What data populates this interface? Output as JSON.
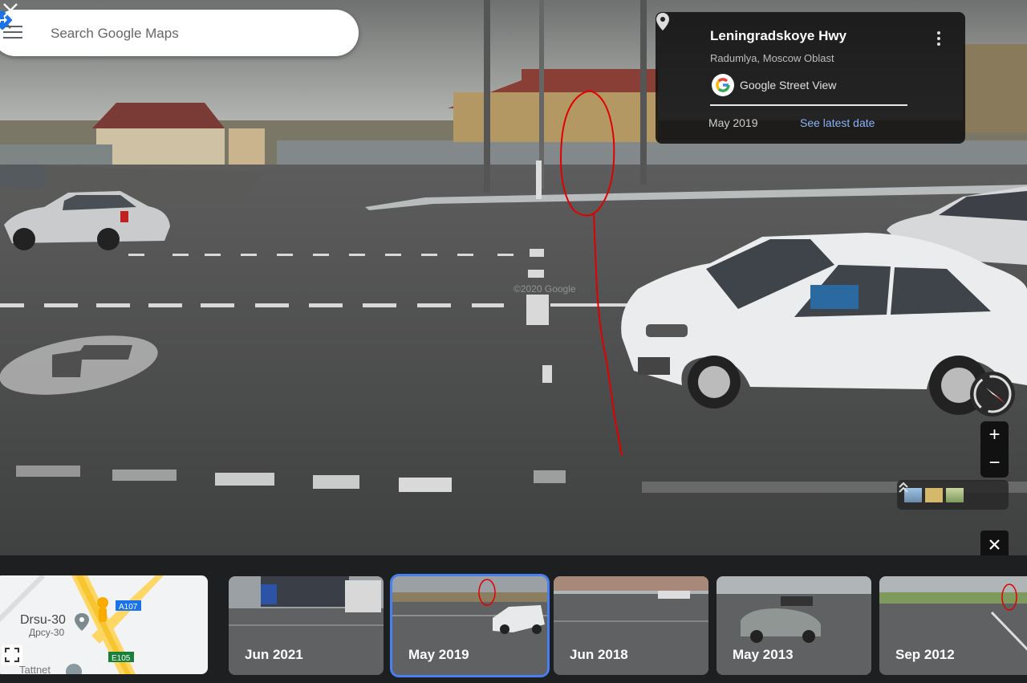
{
  "search": {
    "placeholder": "Search Google Maps"
  },
  "info_card": {
    "title": "Leningradskoye Hwy",
    "subtitle": "Radumlya, Moscow Oblast",
    "source": "Google Street View",
    "date": "May 2019",
    "latest_link": "See latest date"
  },
  "scene": {
    "watermark": "©2020 Google"
  },
  "minimap": {
    "place_name": "Drsu-30",
    "place_name_ru": "Дрсу-30",
    "road_a107": "A107",
    "road_e105": "E105",
    "partial_label": "Tattnet"
  },
  "timeline": [
    {
      "label": "Jun 2021",
      "selected": false
    },
    {
      "label": "May 2019",
      "selected": true
    },
    {
      "label": "Jun 2018",
      "selected": false
    },
    {
      "label": "May 2013",
      "selected": false
    },
    {
      "label": "Sep 2012",
      "selected": false
    }
  ],
  "colors": {
    "annotation": "#e00000",
    "link": "#8ab4f8",
    "selected_border": "#4a7ff0"
  }
}
